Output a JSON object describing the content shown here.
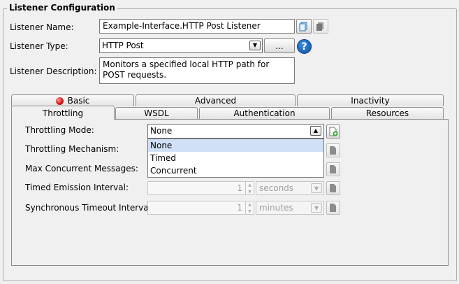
{
  "group": {
    "title": "Listener Configuration"
  },
  "form": {
    "name_label": "Listener Name:",
    "name_value": "Example-Interface.HTTP Post Listener",
    "type_label": "Listener Type:",
    "type_value": "HTTP Post",
    "type_more_button": "...",
    "help_icon": "?",
    "description_label": "Listener Description:",
    "description_value": "Monitors a specified local HTTP path for POST requests."
  },
  "tabs": {
    "back_row": [
      {
        "label": "Basic",
        "error": true
      },
      {
        "label": "Advanced"
      },
      {
        "label": "Inactivity"
      }
    ],
    "front_row": [
      {
        "label": "Throttling",
        "active": true
      },
      {
        "label": "WSDL"
      },
      {
        "label": "Authentication"
      },
      {
        "label": "Resources"
      }
    ]
  },
  "throttling": {
    "mode_label": "Throttling Mode:",
    "mode_value": "None",
    "mode_options": [
      "None",
      "Timed",
      "Concurrent"
    ],
    "mechanism_label": "Throttling Mechanism:",
    "max_concurrent_label": "Max Concurrent Messages:",
    "timed_emission_label": "Timed Emission Interval:",
    "timed_emission_value": "1",
    "timed_emission_unit": "seconds",
    "sync_timeout_label": "Synchronous Timeout Interval:",
    "sync_timeout_value": "1",
    "sync_timeout_unit": "minutes"
  },
  "icons": {
    "copy": "copy-icon",
    "paste": "paste-icon",
    "help": "help-icon",
    "add_variable": "add-variable-icon",
    "error": "error-dot-icon"
  },
  "colors": {
    "help_blue": "#0b4fa6",
    "error_red": "#d81010",
    "selection": "#cfe0f7"
  }
}
